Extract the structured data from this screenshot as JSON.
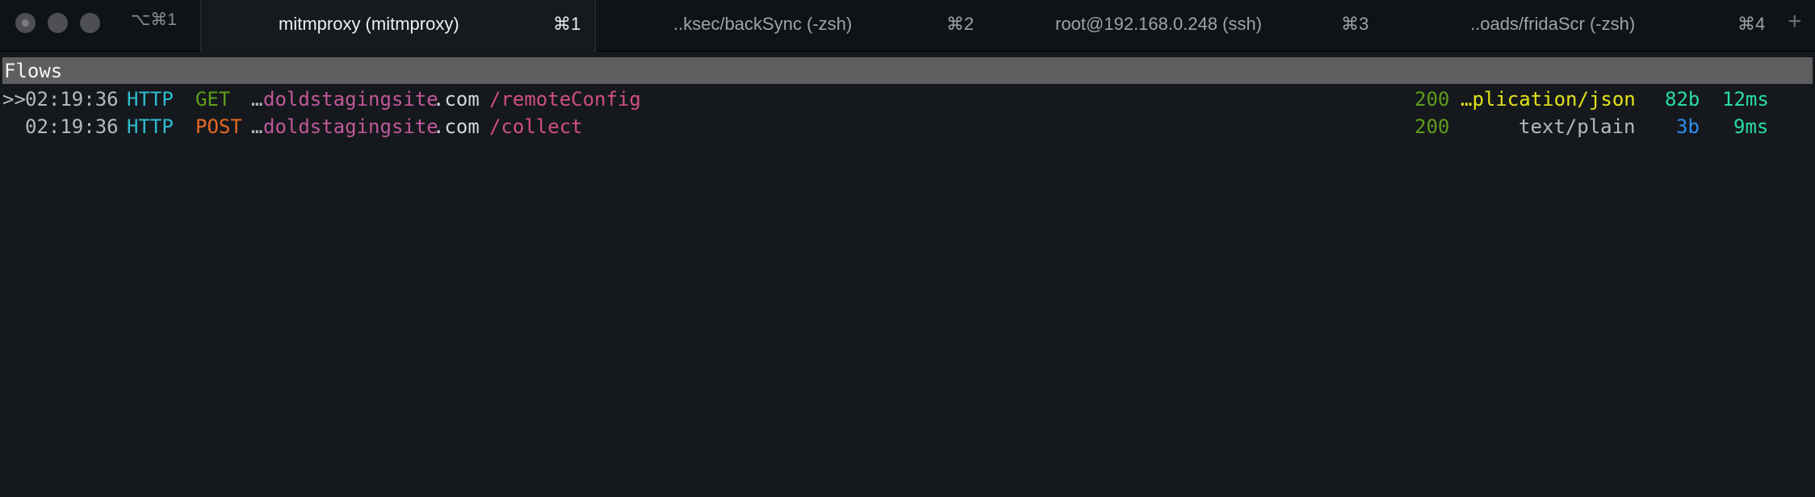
{
  "window": {
    "shortcut_prefix": "⌥⌘1"
  },
  "tabs": [
    {
      "title": "mitmproxy (mitmproxy)",
      "key": "⌘1",
      "active": true
    },
    {
      "title": "..ksec/backSync (-zsh)",
      "key": "⌘2",
      "active": false
    },
    {
      "title": "root@192.168.0.248 (ssh)",
      "key": "⌘3",
      "active": false
    },
    {
      "title": "..oads/fridaScr (-zsh)",
      "key": "⌘4",
      "active": false
    }
  ],
  "new_tab_label": "+",
  "terminal": {
    "header": "Flows",
    "flows": [
      {
        "marker": ">>",
        "time": "02:19:36",
        "scheme": "HTTP",
        "method": "GET",
        "host_prefix": "…",
        "host": "doldstagingsite",
        "tld": ".com",
        "path": "/remoteConfig",
        "status": "200",
        "content_type": "…plication/json",
        "size": "82b",
        "duration": "12ms"
      },
      {
        "marker": "",
        "time": "02:19:36",
        "scheme": "HTTP",
        "method": "POST",
        "host_prefix": "…",
        "host": "doldstagingsite",
        "tld": ".com",
        "path": "/collect",
        "status": "200",
        "content_type": "text/plain",
        "size": "3b",
        "duration": "9ms"
      }
    ]
  },
  "colors": {
    "scheme": "#2fbcd0",
    "get": "#5e9c1c",
    "post": "#e76a25",
    "host": "#c0589a",
    "path": "#d04e84",
    "status_ok": "#5e9c1c",
    "json_type": "#e3e21a",
    "size_green": "#29dca8",
    "size_blue": "#2f8cf0"
  }
}
